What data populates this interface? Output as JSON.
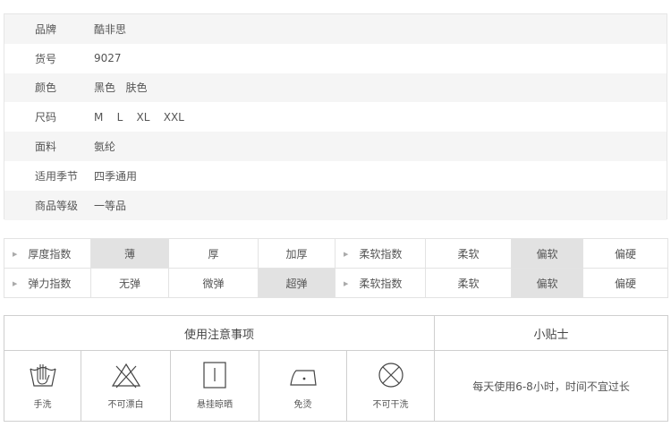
{
  "specs": [
    {
      "label": "品牌",
      "value": "酷非思"
    },
    {
      "label": "货号",
      "value": "9027"
    },
    {
      "label": "颜色",
      "value": "黑色   肤色"
    },
    {
      "label": "尺码",
      "value": "M    L    XL    XXL"
    },
    {
      "label": "面料",
      "value": "氨纶"
    },
    {
      "label": "适用季节",
      "value": "四季通用"
    },
    {
      "label": "商品等级",
      "value": "一等品"
    }
  ],
  "indices": {
    "row1": {
      "label_a": "厚度指数",
      "a1": "薄",
      "a2": "厚",
      "a3": "加厚",
      "label_b": "柔软指数",
      "b1": "柔软",
      "b2": "偏软",
      "b3": "偏硬"
    },
    "row2": {
      "label_a": "弹力指数",
      "a1": "无弹",
      "a2": "微弹",
      "a3": "超弹",
      "label_b": "柔软指数",
      "b1": "柔软",
      "b2": "偏软",
      "b3": "偏硬"
    }
  },
  "care": {
    "title": "使用注意事项",
    "tips_title": "小贴士",
    "items": [
      {
        "icon": "hand-wash-icon",
        "label": "手洗"
      },
      {
        "icon": "no-bleach-icon",
        "label": "不可漂白"
      },
      {
        "icon": "hang-dry-icon",
        "label": "悬挂晾晒"
      },
      {
        "icon": "no-iron-icon",
        "label": "免烫"
      },
      {
        "icon": "no-dry-clean-icon",
        "label": "不可干洗"
      }
    ],
    "tip_text": "每天使用6-8小时，时间不宜过长"
  },
  "colors": {
    "selected_cell": "#e2e2e2",
    "stripe": "#f5f5f5"
  }
}
